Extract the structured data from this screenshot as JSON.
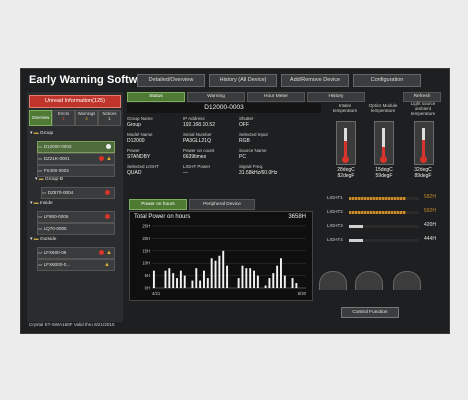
{
  "header": {
    "title": "Early Warning Software",
    "buttons": [
      "Detailed/Overview",
      "History (All Device)",
      "Add/Remove Device",
      "Configuration"
    ]
  },
  "sidebar": {
    "unread": "Unread Information(125)",
    "tabs": [
      "Overview",
      "Errors",
      "Warnings",
      "Notices"
    ],
    "counts": [
      "1",
      "4",
      "1"
    ],
    "group1": "Group",
    "devices1": [
      "D12000-0003",
      "DZ21K-0001",
      "FX400-0002"
    ],
    "group2": "Group-B",
    "devices2": [
      "DZ870-0004"
    ],
    "group3": "Inside",
    "devices3": [
      "LF900-0006",
      "LQ70-0005"
    ],
    "group4": "Outside",
    "devices4": [
      "LFX600-06",
      "LFX6000-0..."
    ]
  },
  "content": {
    "tabs": [
      "Status",
      "Warning",
      "Hour Meter",
      "History"
    ],
    "refresh": "Refresh",
    "device_title": "D12000-0003",
    "info": [
      {
        "label": "Group Name",
        "value": "Group"
      },
      {
        "label": "IP Address",
        "value": "192.168.10.52"
      },
      {
        "label": "Shutter",
        "value": "OFF"
      },
      {
        "label": "Model Name",
        "value": "D12000"
      },
      {
        "label": "Serial Number",
        "value": "PA3GLL21Q"
      },
      {
        "label": "Selected Input",
        "value": "RGB"
      },
      {
        "label": "Power",
        "value": "STANDBY"
      },
      {
        "label": "Power on count",
        "value": "6639times"
      },
      {
        "label": "Source Name",
        "value": "PC"
      },
      {
        "label": "Selected LIGHT",
        "value": "QUAD"
      },
      {
        "label": "LIGHT Power",
        "value": "---"
      },
      {
        "label": "Signal Freq.",
        "value": "31.58kHz/60.0Hz"
      }
    ],
    "temps": {
      "headers": [
        "Intake temperature",
        "Optics Module temperature",
        "Light source ambient temperature"
      ],
      "values": [
        "28degC",
        "15degC",
        "32degC"
      ],
      "values_f": [
        "82degF",
        "59degF",
        "89degF"
      ],
      "fill_fraction": [
        0.55,
        0.35,
        0.6
      ]
    },
    "lights": [
      {
        "label": "LIGHT1",
        "value": "582H",
        "fraction": 0.82
      },
      {
        "label": "LIGHT2",
        "value": "592H",
        "fraction": 0.82
      },
      {
        "label": "LIGHT3",
        "value": "420H",
        "fraction": 0.2
      },
      {
        "label": "LIGHT4",
        "value": "444H",
        "fraction": 0.2
      }
    ],
    "subtabs": [
      "Power on hours",
      "Peripheral Device"
    ],
    "control_btn": "Control Function"
  },
  "chart_data": {
    "type": "bar",
    "title": "Total Power on hours",
    "total": "3658H",
    "yticks": [
      "25H",
      "20H",
      "15H",
      "10H",
      "5H",
      "0H"
    ],
    "ylim": [
      0,
      25
    ],
    "xticks": [
      "4/21",
      "5/20"
    ],
    "values": [
      7,
      0,
      0,
      7,
      8,
      6,
      4,
      7,
      5,
      0,
      3,
      8,
      3,
      7,
      4,
      12,
      11,
      13,
      15,
      9,
      0,
      0,
      4,
      9,
      8,
      8,
      7,
      5,
      0,
      1,
      4,
      6,
      9,
      12,
      5,
      0,
      4,
      2,
      0,
      0
    ]
  },
  "footer": {
    "crystal": "Crystal ET-SWA160F Valid thru 6/21/2015"
  },
  "colors": {
    "accent_red": "#c0352b",
    "accent_green": "#4e7a34",
    "light_orange": "#c88a2c"
  }
}
